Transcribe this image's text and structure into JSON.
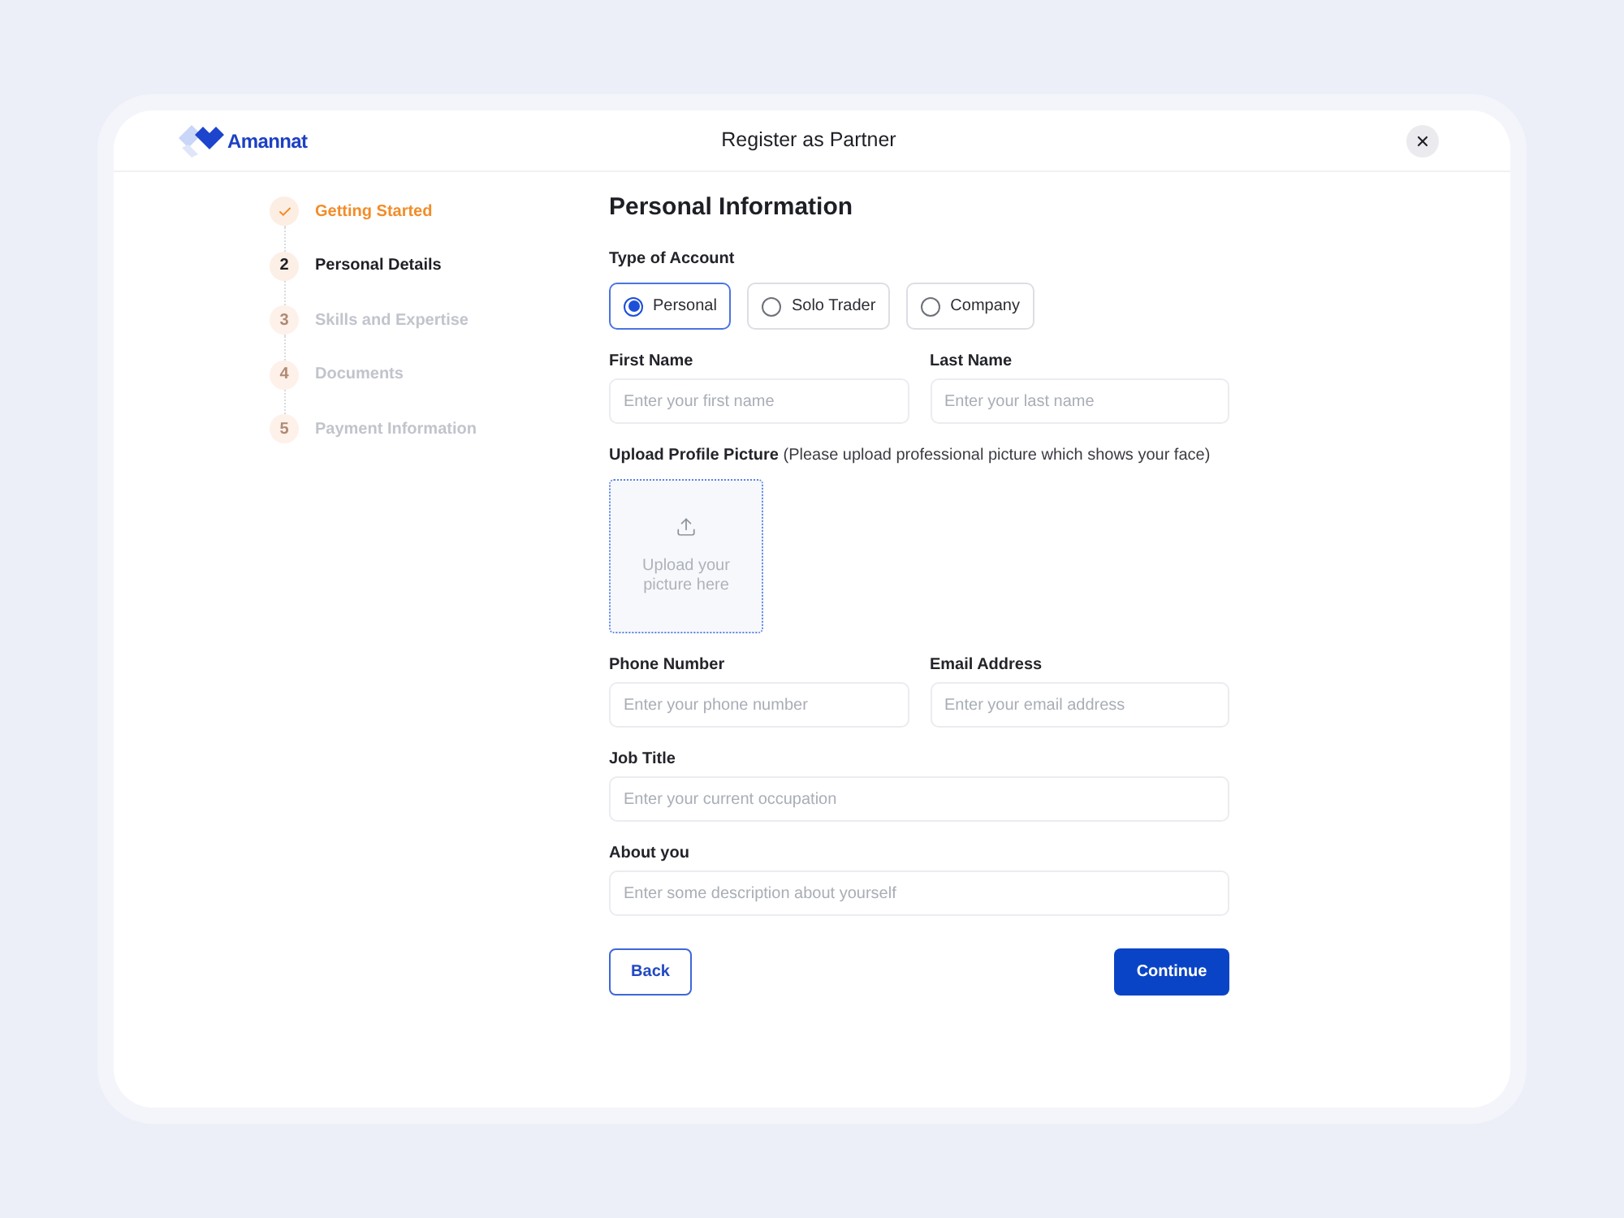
{
  "header": {
    "logo_text": "Amannat",
    "title": "Register as Partner"
  },
  "steps": [
    {
      "completed": true,
      "selected": false,
      "label": "Getting Started"
    },
    {
      "completed": false,
      "selected": true,
      "number": "2",
      "label": "Personal Details"
    },
    {
      "completed": false,
      "selected": false,
      "number": "3",
      "label": "Skills and Expertise"
    },
    {
      "completed": false,
      "selected": false,
      "number": "4",
      "label": "Documents"
    },
    {
      "completed": false,
      "selected": false,
      "number": "5",
      "label": "Payment Information"
    }
  ],
  "form": {
    "title": "Personal Information",
    "account_type": {
      "label": "Type of Account",
      "options": [
        {
          "label": "Personal",
          "selected": true
        },
        {
          "label": "Solo Trader",
          "selected": false
        },
        {
          "label": "Company",
          "selected": false
        }
      ]
    },
    "rows": [
      {
        "kind": "pair",
        "fields": [
          {
            "label": "First Name",
            "placeholder": "Enter your first name"
          },
          {
            "label": "Last Name",
            "placeholder": "Enter your last name"
          }
        ]
      },
      {
        "kind": "upload",
        "label": "**Upload Profile Picture** (Please upload professional picture which shows your face)",
        "prompt": "Upload your picture here"
      },
      {
        "kind": "pair",
        "fields": [
          {
            "label": "Phone Number",
            "placeholder": "Enter your phone number"
          },
          {
            "label": "Email Address",
            "placeholder": "Enter your email address"
          }
        ]
      },
      {
        "kind": "single",
        "fields": [
          {
            "label": "Job Title",
            "placeholder": "Enter your current occupation"
          }
        ]
      },
      {
        "kind": "single",
        "fields": [
          {
            "label": "About you",
            "placeholder": "Enter some description about yourself"
          }
        ]
      }
    ],
    "buttons": [
      {
        "kind": "secondary",
        "label": "Back"
      },
      {
        "kind": "primary",
        "label": "Continue"
      }
    ]
  }
}
